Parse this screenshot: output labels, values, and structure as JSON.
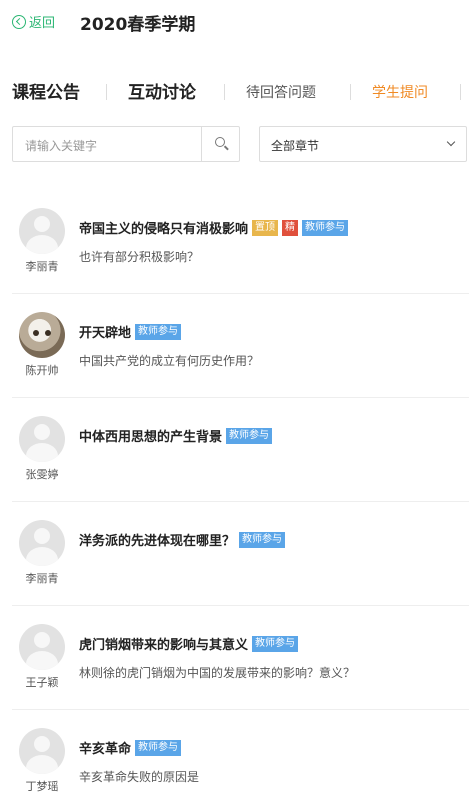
{
  "header": {
    "back_label": "返回",
    "title": "2020春季学期"
  },
  "tabs": [
    {
      "label": "课程公告"
    },
    {
      "label": "互动讨论"
    },
    {
      "label": "待回答问题"
    },
    {
      "label": "学生提问"
    }
  ],
  "search": {
    "placeholder": "请输入关键字"
  },
  "chapter_select": {
    "value": "全部章节"
  },
  "questions": [
    {
      "user": "李丽青",
      "title": "帝国主义的侵略只有消极影响",
      "badges": [
        "置顶",
        "精",
        "教师参与"
      ],
      "desc": "也许有部分积极影响？"
    },
    {
      "user": "陈开帅",
      "title": "开天辟地",
      "badges": [
        "教师参与"
      ],
      "desc": "中国共产党的成立有何历史作用？"
    },
    {
      "user": "张雯婷",
      "title": "中体西用思想的产生背景",
      "badges": [
        "教师参与"
      ],
      "desc": ""
    },
    {
      "user": "李丽青",
      "title": "洋务派的先进体现在哪里？",
      "badges": [
        "教师参与"
      ],
      "desc": ""
    },
    {
      "user": "王子颖",
      "title": "虎门销烟带来的影响与其意义",
      "badges": [
        "教师参与"
      ],
      "desc": "林则徐的虎门销烟为中国的发展带来的影响？意义？"
    },
    {
      "user": "丁梦瑶",
      "title": "辛亥革命",
      "badges": [
        "教师参与"
      ],
      "desc": "辛亥革命失败的原因是"
    }
  ]
}
